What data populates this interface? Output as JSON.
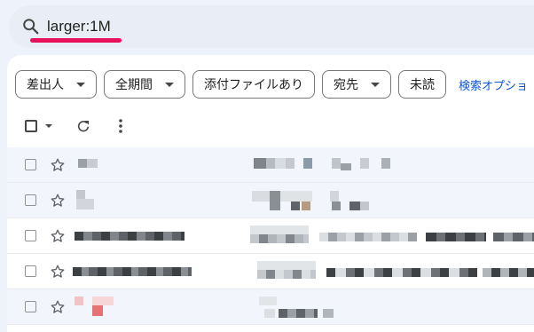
{
  "search": {
    "query": "larger:1M",
    "underline_color": "#e8115b"
  },
  "filters": {
    "chips": [
      {
        "label": "差出人",
        "dropdown": true
      },
      {
        "label": "全期間",
        "dropdown": true
      },
      {
        "label": "添付ファイルあり",
        "dropdown": false
      },
      {
        "label": "宛先",
        "dropdown": true
      },
      {
        "label": "未読",
        "dropdown": false
      }
    ],
    "advanced_link": "検索オプショ"
  },
  "toolbar": {
    "select_all": "checkbox-icon",
    "select_menu": "caret-down-icon",
    "refresh": "refresh-icon",
    "more": "more-vert-icon"
  },
  "colors": {
    "accent": "#0b57d0",
    "read_row": "#f2f6fc",
    "unread_row": "#ffffff",
    "app_bg": "#eef3fb"
  },
  "emails": [
    {
      "state": "read",
      "redacted": true
    },
    {
      "state": "read",
      "redacted": true
    },
    {
      "state": "unread",
      "redacted": true
    },
    {
      "state": "unread",
      "redacted": true
    },
    {
      "state": "read",
      "redacted": true
    }
  ]
}
